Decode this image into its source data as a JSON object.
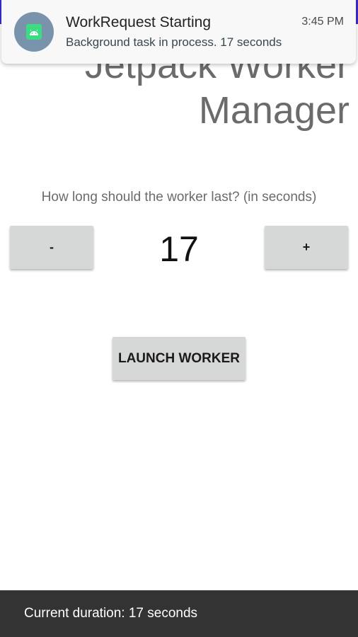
{
  "app": {
    "title_line1": "Jetpack Worker",
    "title_line2": "Manager"
  },
  "notification": {
    "icon": "android-icon",
    "title": "WorkRequest Starting",
    "time": "3:45 PM",
    "body": "Background task in process. 17 seconds"
  },
  "main": {
    "prompt": "How long should the worker last? (in seconds)",
    "decrement_label": "-",
    "increment_label": "+",
    "duration": "17",
    "launch_label": "LAUNCH WORKER"
  },
  "snackbar": {
    "text": "Current duration: 17 seconds"
  },
  "colors": {
    "status_bar": "#3a2bd6",
    "button_bg": "#d6d7d7",
    "snackbar_bg": "#333333",
    "android_green": "#3ddc84"
  }
}
